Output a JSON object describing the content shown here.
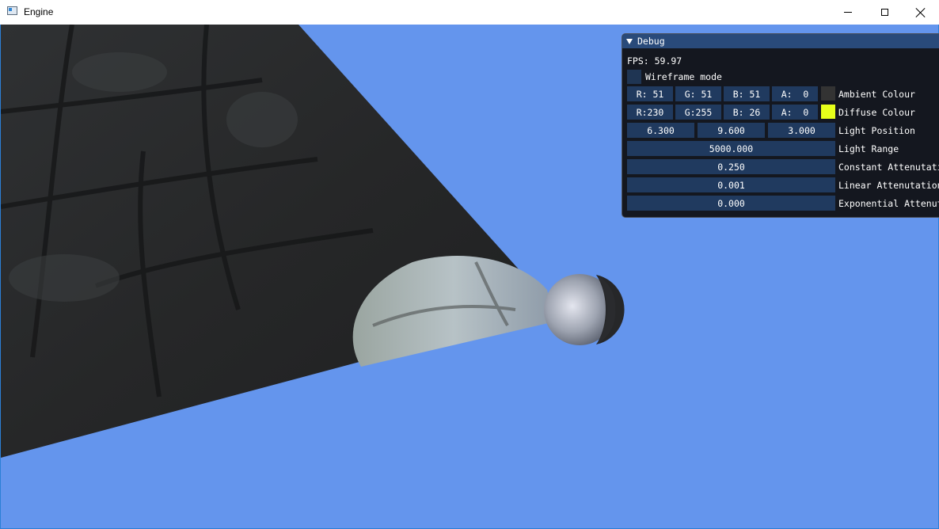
{
  "window": {
    "title": "Engine"
  },
  "debug": {
    "header": "Debug",
    "fps": "FPS: 59.97",
    "wireframe_label": "Wireframe mode",
    "ambient": {
      "r": "R: 51",
      "g": "G: 51",
      "b": "B: 51",
      "a": "A:  0",
      "label": "Ambient Colour",
      "swatch_color": "#333333"
    },
    "diffuse": {
      "r": "R:230",
      "g": "G:255",
      "b": "B: 26",
      "a": "A:  0",
      "label": "Diffuse Colour",
      "swatch_color": "#e6ff1a"
    },
    "light_position": {
      "x": "6.300",
      "y": "9.600",
      "z": "3.000",
      "label": "Light Position"
    },
    "light_range": {
      "value": "5000.000",
      "label": "Light Range"
    },
    "constant": {
      "value": "0.250",
      "label": "Constant Attenutation"
    },
    "linear": {
      "value": "0.001",
      "label": "Linear Attenutation"
    },
    "exponential": {
      "value": "0.000",
      "label": "Exponential Attenutation"
    }
  },
  "colors": {
    "sky": "#6495ed",
    "panel_bg": "#0f0f12",
    "panel_header": "#294a7a",
    "field_bg": "#203a5f",
    "window_border": "#2c7fd6"
  }
}
